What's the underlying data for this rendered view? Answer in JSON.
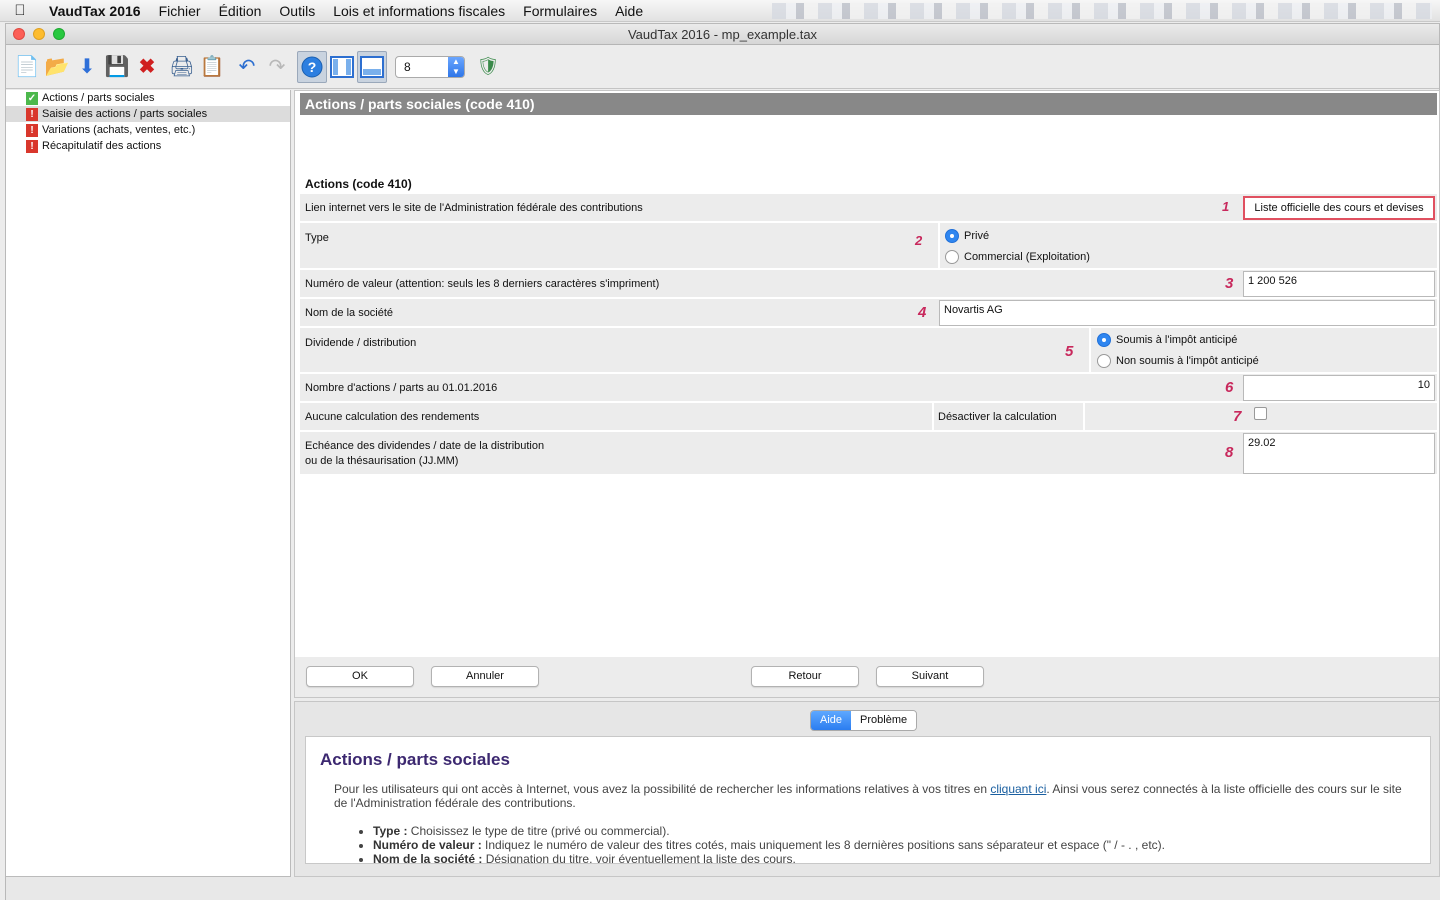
{
  "menubar": {
    "app_name": "VaudTax 2016",
    "items": [
      "Fichier",
      "Édition",
      "Outils",
      "Lois et informations fiscales",
      "Formulaires",
      "Aide"
    ]
  },
  "window": {
    "title": "VaudTax 2016 - mp_example.tax"
  },
  "toolbar": {
    "page_select_value": "8"
  },
  "tree": {
    "items": [
      {
        "label": "Actions / parts sociales",
        "status": "ok"
      },
      {
        "label": "Saisie des actions / parts sociales",
        "status": "error"
      },
      {
        "label": "Variations (achats, ventes, etc.)",
        "status": "error"
      },
      {
        "label": "Récapitulatif des actions",
        "status": "error"
      }
    ]
  },
  "form": {
    "header": "Actions / parts sociales (code 410)",
    "subtitle": "Actions (code 410)",
    "rows": {
      "link": {
        "label": "Lien internet vers le site de l'Administration fédérale des contributions",
        "num": "1",
        "button": "Liste officielle des cours et devises"
      },
      "type": {
        "label": "Type",
        "num": "2",
        "options": [
          "Privé",
          "Commercial (Exploitation)"
        ],
        "selected": "Privé"
      },
      "valeur": {
        "label": "Numéro de valeur (attention: seuls les 8 derniers caractères s'impriment)",
        "num": "3",
        "value": "1 200 526"
      },
      "societe": {
        "label": "Nom de la société",
        "num": "4",
        "value": "Novartis AG"
      },
      "dividende": {
        "label": "Dividende / distribution",
        "num": "5",
        "options": [
          "Soumis à l'impôt anticipé",
          "Non soumis à l'impôt anticipé"
        ],
        "selected": "Soumis à l'impôt anticipé"
      },
      "nombre": {
        "label": "Nombre d'actions / parts au 01.01.2016",
        "num": "6",
        "value": "10"
      },
      "calcul": {
        "label": "Aucune calculation des rendements",
        "label2": "Désactiver la calculation",
        "num": "7",
        "checked": false
      },
      "echeance": {
        "label_line1": "Echéance des dividendes / date de la distribution",
        "label_line2": "ou de la thésaurisation (JJ.MM)",
        "num": "8",
        "value": "29.02"
      }
    }
  },
  "buttons": {
    "ok": "OK",
    "cancel": "Annuler",
    "back": "Retour",
    "next": "Suivant"
  },
  "help": {
    "tabs": [
      "Aide",
      "Problème"
    ],
    "active_tab": "Aide",
    "title": "Actions / parts sociales",
    "para_before_link": "Pour les utilisateurs qui ont accès à Internet, vous avez la possibilité de rechercher les informations relatives à vos titres en ",
    "link_text": "cliquant ici",
    "para_after_link": ". Ainsi vous serez connectés à la liste officielle des cours sur le site de l'Administration fédérale des contributions.",
    "bullets": [
      {
        "term": "Type :",
        "text": " Choisissez le type de titre (privé ou commercial)."
      },
      {
        "term": "Numéro de valeur :",
        "text": " Indiquez le numéro de valeur des titres cotés, mais uniquement les 8 dernières positions sans séparateur et espace (\" / - . , etc)."
      },
      {
        "term": "Nom de la société :",
        "text": " Désignation du titre, voir éventuellement la liste des cours."
      }
    ]
  },
  "colors": {
    "header_bg": "#888888",
    "accent_blue": "#2f86f0",
    "number_pink": "#c8285c",
    "error_red": "#d9372c",
    "ok_green": "#4cb84c"
  }
}
